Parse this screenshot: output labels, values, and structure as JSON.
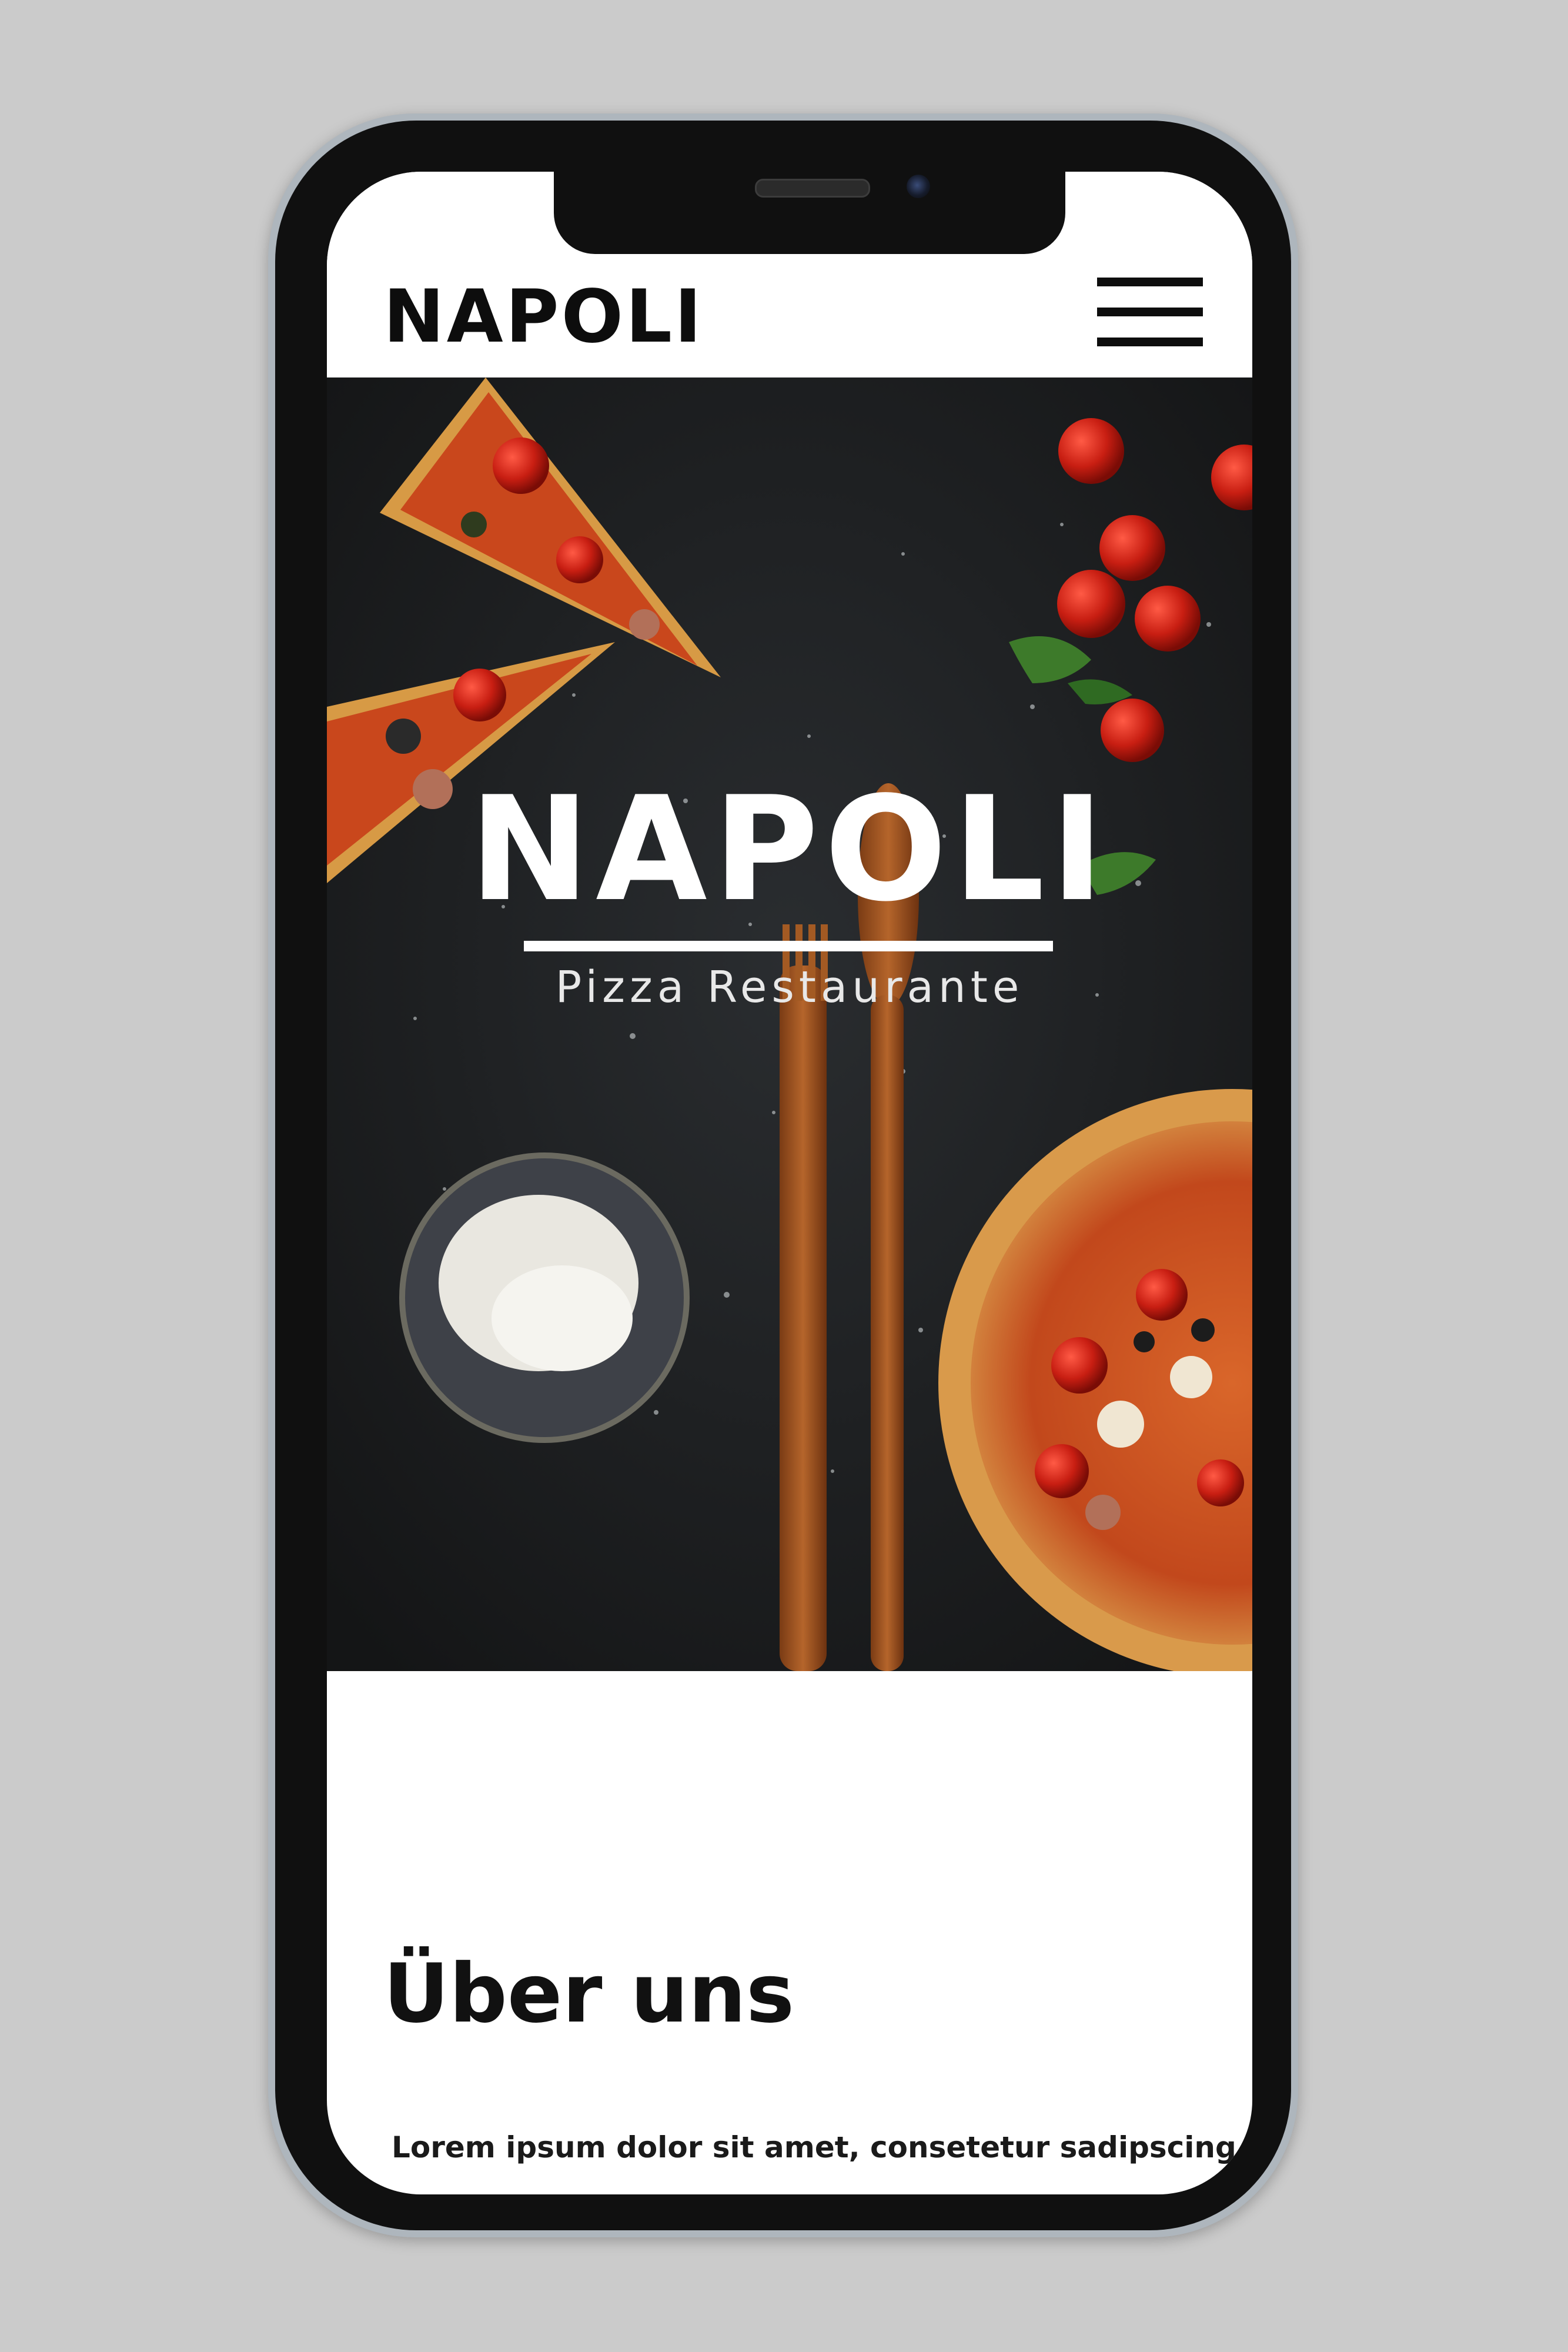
{
  "header": {
    "brand": "NAPOLI",
    "menu_icon": "hamburger-menu-icon"
  },
  "hero": {
    "title": "NAPOLI",
    "subtitle": "Pizza Restaurante",
    "image_alt": "pizza-table-photo"
  },
  "about": {
    "heading": "Über uns",
    "text": "Lorem ipsum dolor sit amet, consetetur sadipscing"
  },
  "colors": {
    "background": "#cbcbcb",
    "phone_frame": "#101010",
    "screen": "#ffffff",
    "hero_background": "#202224",
    "text_dark": "#0d0d0d",
    "text_light": "#ffffff"
  }
}
